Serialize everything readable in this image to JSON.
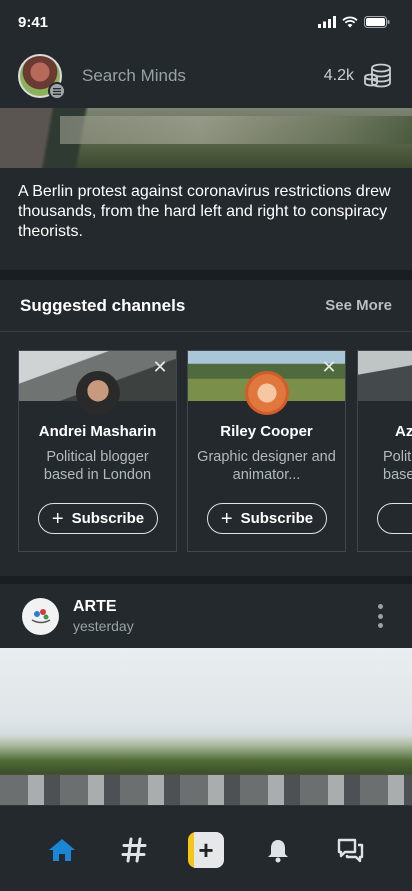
{
  "status_bar": {
    "time": "9:41"
  },
  "header": {
    "search_placeholder": "Search Minds",
    "token_count": "4.2k"
  },
  "featured_post": {
    "caption": "A Berlin protest against coronavirus restrictions drew thousands, from the hard left and right to conspiracy theorists."
  },
  "suggested_channels": {
    "title": "Suggested channels",
    "see_more_label": "See More",
    "cards": [
      {
        "name": "Andrei Masharin",
        "description": "Political blogger based in London",
        "subscribe_label": "Subscribe"
      },
      {
        "name": "Riley Cooper",
        "description": "Graphic designer and animator...",
        "subscribe_label": "Subscribe"
      },
      {
        "name": "Az",
        "description": "Polit base",
        "subscribe_label": ""
      }
    ]
  },
  "post": {
    "author": "ARTE",
    "time": "yesterday"
  },
  "colors": {
    "background": "#1f2427",
    "surface": "#23292c",
    "accent_home": "#1b85d6",
    "compose_accent": "#f5c518"
  },
  "tab_bar": {
    "icons": [
      "home-icon",
      "hashtag-icon",
      "compose-icon",
      "bell-icon",
      "chat-icon"
    ]
  }
}
